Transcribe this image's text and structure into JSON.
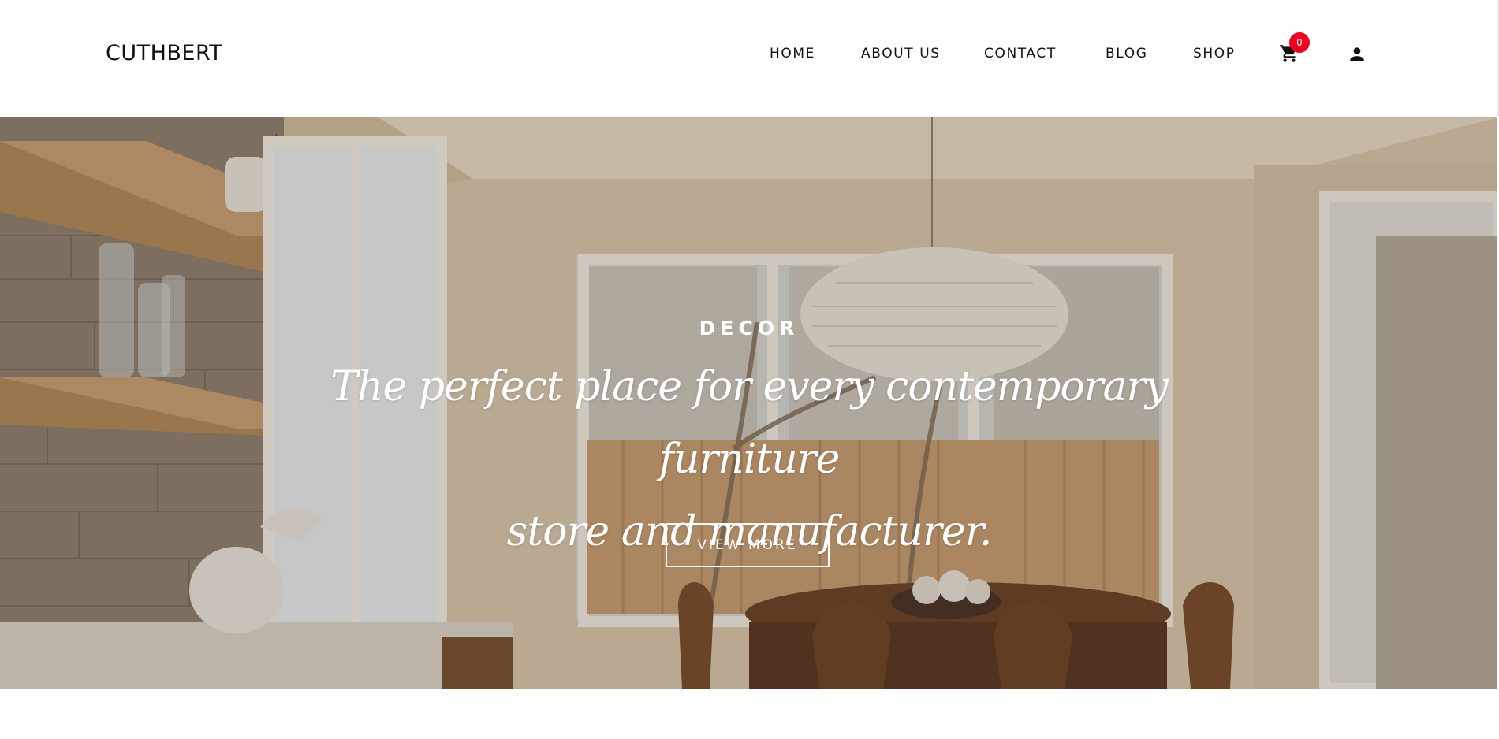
{
  "header": {
    "logo": "CUTHBERT",
    "nav": [
      {
        "label": "HOME"
      },
      {
        "label": "ABOUT US"
      },
      {
        "label": "CONTACT"
      },
      {
        "label": "BLOG"
      },
      {
        "label": "SHOP"
      }
    ],
    "cart_count": "0",
    "cart_icon": "shopping-cart-icon",
    "user_icon": "user-icon"
  },
  "hero": {
    "kicker": "DECOR",
    "title_line1": "The perfect place for every contemporary furniture",
    "title_line2": "store and manufacturer.",
    "button_label": "VIEW MORE",
    "image_subject": "bright dining room with pendant lamp, wooden table and chairs, kitchen shelves"
  },
  "colors": {
    "badge": "#f2001e",
    "text_dark": "#111111",
    "hero_text": "#ffffff"
  }
}
